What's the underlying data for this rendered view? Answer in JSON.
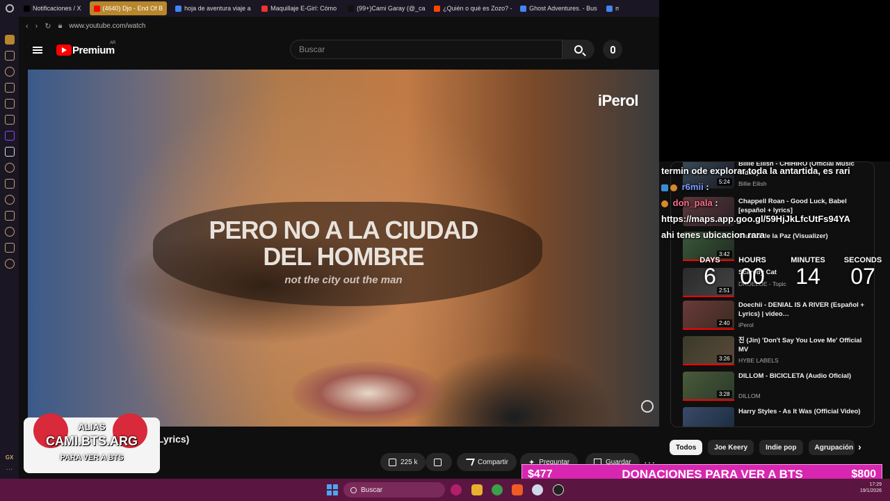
{
  "browser": {
    "tabs": [
      {
        "label": "Notificaciones / X",
        "color": "#000000"
      },
      {
        "label": "(4640) Djo - End Of B",
        "color": "#ff0000",
        "active": true
      },
      {
        "label": "hoja de aventura viaje a",
        "color": "#4285f4"
      },
      {
        "label": "Maquillaje E-Girl: Cómo",
        "color": "#e33"
      },
      {
        "label": "(99+)Cami Garay (@_ca",
        "color": "#111111"
      },
      {
        "label": "¿Quién o qué es Zozo? -",
        "color": "#ff4500"
      },
      {
        "label": "Ghost Adventures. - Bus",
        "color": "#4285f4"
      },
      {
        "label": "m",
        "color": "#4285f4"
      }
    ],
    "url": "www.youtube.com/watch"
  },
  "youtube": {
    "brand": "Premium",
    "country": "AR",
    "search_placeholder": "Buscar"
  },
  "video": {
    "channel_watermark": "iPerol",
    "lyric_line1": "PERO NO A LA CIUDAD",
    "lyric_line2": "DEL HOMBRE",
    "lyric_translation": "not the city out the man",
    "title_visible": "ñol + Lyrics)",
    "likes": "225 k",
    "share_label": "Compartir",
    "ask_label": "Preguntar",
    "save_label": "Guardar"
  },
  "recommendations": [
    {
      "title": "Billie Eilish - CHIHIRO (Official Music Video)",
      "channel": "Billie Eilish",
      "duration": "5:24"
    },
    {
      "title": "Chappell Roan - Good Luck, Babel [español + lyrics]",
      "channel": "",
      "duration": ""
    },
    {
      "title": "Ciudad de la Paz (Visualizer)",
      "channel": "",
      "duration": "3:42"
    },
    {
      "title": "Scaredy Cat",
      "channel": "DROELOE - Topic",
      "duration": "2:51"
    },
    {
      "title": "Doechii - DENIAL IS A RIVER (Español + Lyrics) | video…",
      "channel": "iPerol",
      "duration": "2:40"
    },
    {
      "title": "진 (Jin) 'Don't Say You Love Me' Official MV",
      "channel": "HYBE LABELS",
      "duration": "3:26"
    },
    {
      "title": "DILLOM - BICICLETA (Audio Oficial)",
      "channel": "DILLOM",
      "duration": "3:28"
    },
    {
      "title": "Harry Styles - As It Was (Official Video)",
      "channel": "",
      "duration": ""
    }
  ],
  "chips": [
    "Todos",
    "Joe Keery",
    "Indie pop",
    "Agrupación m"
  ],
  "chat": {
    "line1": "termin ode explorar toda la antartida, es rari",
    "user1": "r6mii",
    "user2": "don_pala",
    "link": "https://maps.app.goo.gl/59HjJkLfcUtFs94YA",
    "line_after": "ahi tenes ubicacion rara"
  },
  "countdown": {
    "days_label": "DAYS",
    "days": "6",
    "hours_label": "HOURS",
    "hours": "00",
    "minutes_label": "MINUTES",
    "minutes": "14",
    "seconds_label": "SECONDS",
    "seconds": "07"
  },
  "alias_overlay": {
    "label": "ALIAS",
    "alias": "CAMI.BTS.ARG",
    "sub": "PARA VER A BTS"
  },
  "donations": {
    "current": "$477",
    "label": "DONACIONES PARA VER A BTS",
    "goal": "$800"
  },
  "taskbar": {
    "search_label": "Buscar",
    "time": "17:29",
    "date": "19/1/2026"
  }
}
